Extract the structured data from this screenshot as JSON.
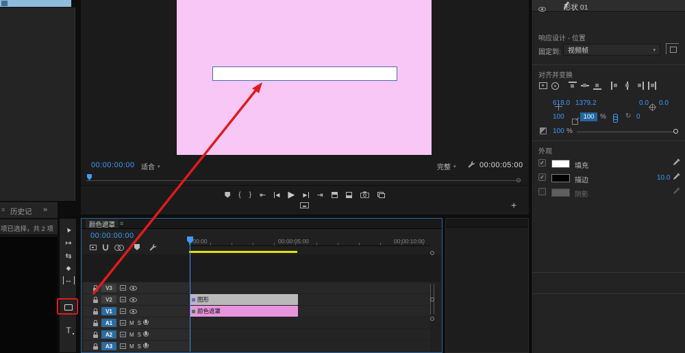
{
  "colors": {
    "accent_blue": "#3f9bfa",
    "canvas_pink": "#f8c7f6",
    "clip_gray": "#b9b9b9",
    "clip_pink": "#e894dd",
    "track_chip_blue": "#2d6ca2",
    "work_bar_yellow": "#e2e200",
    "highlight_red": "#e01b1b"
  },
  "glyphs": {
    "menu": "≡",
    "double_chevron": "»",
    "dropdown_arrow": "▾",
    "plus": "+",
    "check": "✓",
    "brace_open": "{",
    "brace_close": "}",
    "goto_in": "⇤",
    "goto_out": "⇥",
    "step_back": "◀",
    "play": "▶",
    "step_forward": "▶",
    "selection_tool": "▲",
    "track_select_tool": "↦",
    "ripple_edit_tool": "⇆",
    "razor_tool": "◆",
    "slip_tool": "↔",
    "type_tool": "T",
    "rotate": "↻"
  },
  "left_panel": {
    "history_tab": "历史记",
    "selection_status": "项已选择，共 2 项"
  },
  "monitor": {
    "timecode": "00:00:00:00",
    "fit": "适合",
    "quality": "完整",
    "duration": "00:00:05:00"
  },
  "timeline": {
    "tab_label": "颜色遮罩",
    "timecode": "00:00:00:00",
    "ruler_labels": [
      ":00:00",
      "00:00:05:00",
      "00:00:10:00"
    ],
    "video_tracks": [
      "V3",
      "V2",
      "V1"
    ],
    "audio_tracks": [
      "A1",
      "A2",
      "A3"
    ],
    "mute_label": "M",
    "solo_label": "S",
    "clips": [
      {
        "track": "V2",
        "name": "图形"
      },
      {
        "track": "V1",
        "name": "颜色遮罩"
      }
    ]
  },
  "inspector": {
    "title": "形状 01",
    "responsive_section": "响应设计 - 位置",
    "pin_to_label": "固定到:",
    "pin_to_value": "视频帧",
    "align_section": "对齐并变换",
    "position": {
      "x": "618.0",
      "y": "1379.2"
    },
    "anchor": {
      "x": "0.0",
      "y": "0.0"
    },
    "scale": "100",
    "scale_width": "100",
    "percent": "%",
    "rotation": "0",
    "opacity": "100",
    "opacity_percent": "%",
    "appearance_section": "外观",
    "fill_label": "填充",
    "stroke_label": "描边",
    "stroke_width": "10.0",
    "shadow_label": "阴影"
  }
}
